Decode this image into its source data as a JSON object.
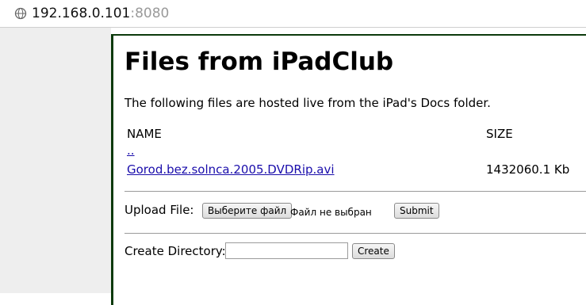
{
  "browser": {
    "url_host": "192.168.0.101",
    "url_port": ":8080"
  },
  "page": {
    "title": "Files from iPadClub",
    "intro": "The following files are hosted live from the iPad's Docs folder."
  },
  "file_table": {
    "headers": {
      "name": "NAME",
      "size": "SIZE"
    },
    "rows": [
      {
        "name": "..",
        "size": ""
      },
      {
        "name": "Gorod.bez.solnca.2005.DVDRip.avi",
        "size": "1432060.1 Kb"
      }
    ]
  },
  "upload_form": {
    "label": "Upload File:",
    "choose_button": "Выберите файл",
    "no_file_text": "Файл не выбран",
    "submit_button": "Submit"
  },
  "create_dir_form": {
    "label": "Create Directory:",
    "input_value": "",
    "create_button": "Create"
  }
}
